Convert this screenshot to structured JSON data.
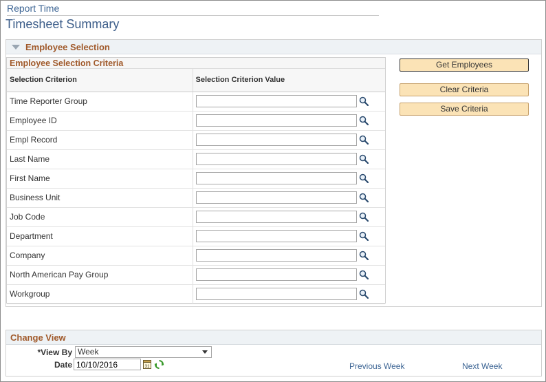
{
  "header": {
    "breadcrumb": "Report Time",
    "title": "Timesheet Summary"
  },
  "employee_selection": {
    "section_title": "Employee Selection",
    "criteria_title": "Employee Selection Criteria",
    "columns": [
      "Selection Criterion",
      "Selection Criterion Value"
    ],
    "rows": [
      {
        "label": "Time Reporter Group",
        "value": ""
      },
      {
        "label": "Employee ID",
        "value": ""
      },
      {
        "label": "Empl Record",
        "value": ""
      },
      {
        "label": "Last Name",
        "value": ""
      },
      {
        "label": "First Name",
        "value": ""
      },
      {
        "label": "Business Unit",
        "value": ""
      },
      {
        "label": "Job Code",
        "value": ""
      },
      {
        "label": "Department",
        "value": ""
      },
      {
        "label": "Company",
        "value": ""
      },
      {
        "label": "North American Pay Group",
        "value": ""
      },
      {
        "label": "Workgroup",
        "value": ""
      }
    ],
    "buttons": {
      "get_employees": "Get Employees",
      "clear_criteria": "Clear Criteria",
      "save_criteria": "Save Criteria"
    }
  },
  "change_view": {
    "section_title": "Change View",
    "view_by_label": "*View By",
    "view_by_value": "Week",
    "date_label": "Date",
    "date_value": "10/10/2016",
    "previous_week": "Previous Week",
    "next_week": "Next Week"
  },
  "icons": {
    "lookup": "magnifier-icon",
    "calendar": "calendar-icon",
    "refresh": "refresh-icon"
  },
  "colors": {
    "section_header_text": "#a0592a",
    "link": "#3d6594",
    "button_fill": "#fbe3b6"
  }
}
